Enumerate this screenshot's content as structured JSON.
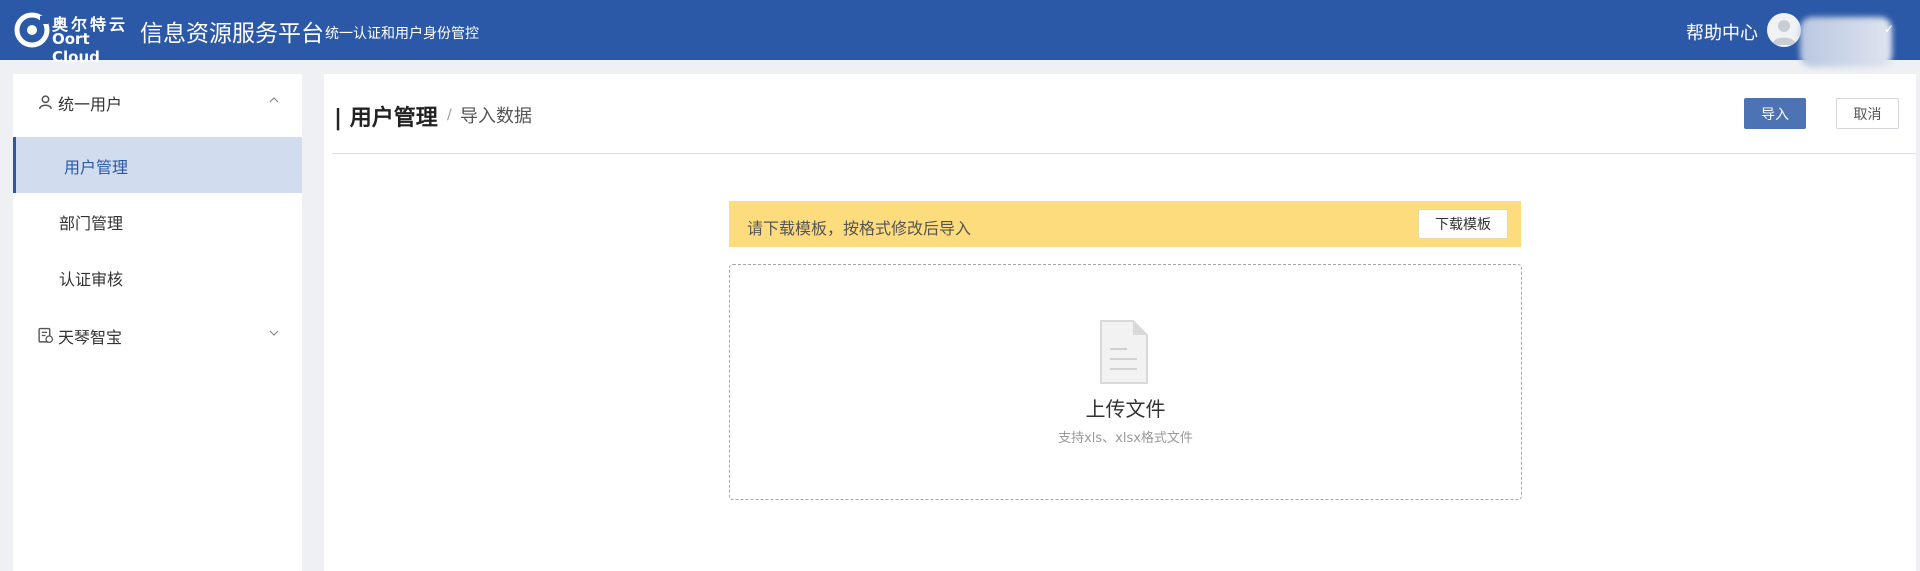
{
  "header": {
    "logo_cn": "奥尔特云",
    "logo_en": "Oort Cloud",
    "app_title": "信息资源服务平台",
    "app_subtitle": "统一认证和用户身份管控",
    "help_label": "帮助中心",
    "user_arrow": "✓"
  },
  "sidebar": {
    "groups": [
      {
        "label": "统一用户",
        "icon": "user-icon",
        "expanded": true,
        "items": [
          {
            "label": "用户管理",
            "active": true
          },
          {
            "label": "部门管理",
            "active": false
          },
          {
            "label": "认证审核",
            "active": false
          }
        ]
      },
      {
        "label": "天琴智宝",
        "icon": "document-shield-icon",
        "expanded": false
      }
    ]
  },
  "main": {
    "title": "| 用户管理",
    "breadcrumb_separator": "/",
    "breadcrumb_current": "导入数据",
    "import_button": "导入",
    "cancel_button": "取消",
    "notice": {
      "text": "请下载模板，按格式修改后导入",
      "download_button": "下载模板",
      "background": "#fddc7e"
    },
    "upload": {
      "title": "上传文件",
      "hint": "支持xls、xlsx格式文件",
      "icon": "file-icon"
    }
  },
  "colors": {
    "brand": "#2b58a7",
    "primary_button": "#4e73b5",
    "active_menu_bg": "#d1dcef"
  }
}
